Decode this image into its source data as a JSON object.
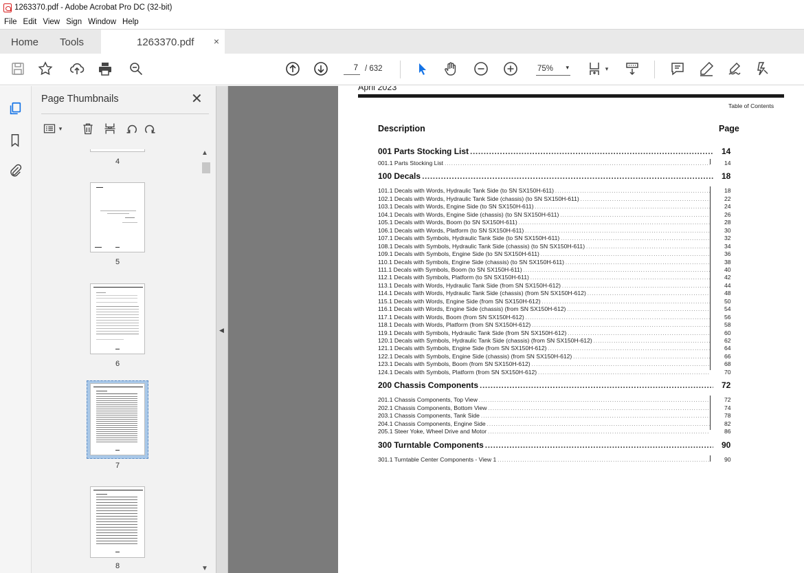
{
  "window": {
    "title": "1263370.pdf - Adobe Acrobat Pro DC (32-bit)"
  },
  "menu": [
    "File",
    "Edit",
    "View",
    "Sign",
    "Window",
    "Help"
  ],
  "tabs": {
    "home": "Home",
    "tools": "Tools",
    "doc": "1263370.pdf",
    "close": "×"
  },
  "toolbar": {
    "page_current": "7",
    "page_total": "/ 632",
    "zoom": "75%"
  },
  "panel": {
    "title": "Page Thumbnails",
    "close": "✕",
    "thumbs": [
      {
        "label": "4"
      },
      {
        "label": "5"
      },
      {
        "label": "6"
      },
      {
        "label": "7"
      },
      {
        "label": "8"
      }
    ]
  },
  "document": {
    "date": "April 2023",
    "toc_label": "Table of Contents",
    "col_description": "Description",
    "col_page": "Page",
    "entries": [
      {
        "kind": "sec",
        "text": "001 Parts Stocking List",
        "page": "14"
      },
      {
        "kind": "sub",
        "text": "001.1 Parts Stocking List",
        "page": "14"
      },
      {
        "kind": "sec",
        "text": "100 Decals",
        "page": "18"
      },
      {
        "kind": "sub",
        "text": "101.1 Decals with Words, Hydraulic Tank Side (to SN SX150H-611)",
        "page": "18"
      },
      {
        "kind": "sub",
        "text": "102.1 Decals with Words, Hydraulic Tank Side (chassis) (to SN SX150H-611)",
        "page": "22"
      },
      {
        "kind": "sub",
        "text": "103.1 Decals with Words, Engine Side (to SN SX150H-611)",
        "page": "24"
      },
      {
        "kind": "sub",
        "text": "104.1 Decals with Words, Engine Side (chassis) (to SN SX150H-611)",
        "page": "26"
      },
      {
        "kind": "sub",
        "text": "105.1 Decals with Words, Boom (to SN SX150H-611)",
        "page": "28"
      },
      {
        "kind": "sub",
        "text": "106.1 Decals with Words, Platform (to SN SX150H-611)",
        "page": "30"
      },
      {
        "kind": "sub",
        "text": "107.1 Decals with Symbols, Hydraulic Tank Side (to SN SX150H-611)",
        "page": "32"
      },
      {
        "kind": "sub",
        "text": "108.1 Decals with Symbols, Hydraulic Tank Side (chassis) (to SN SX150H-611)",
        "page": "34"
      },
      {
        "kind": "sub",
        "text": "109.1 Decals with Symbols, Engine Side (to SN SX150H-611)",
        "page": "36"
      },
      {
        "kind": "sub",
        "text": "110.1 Decals with Symbols, Engine Side (chassis) (to SN SX150H-611)",
        "page": "38"
      },
      {
        "kind": "sub",
        "text": "111.1 Decals with Symbols, Boom (to SN SX150H-611)",
        "page": "40"
      },
      {
        "kind": "sub",
        "text": "112.1 Decals with Symbols, Platform (to SN SX150H-611)",
        "page": "42"
      },
      {
        "kind": "sub",
        "text": "113.1 Decals with Words, Hydraulic Tank Side (from SN SX150H-612)",
        "page": "44"
      },
      {
        "kind": "sub",
        "text": "114.1 Decals with Words, Hydraulic Tank Side (chassis) (from SN SX150H-612)",
        "page": "48"
      },
      {
        "kind": "sub",
        "text": "115.1 Decals with Words, Engine Side (from SN SX150H-612)",
        "page": "50"
      },
      {
        "kind": "sub",
        "text": "116.1 Decals with Words, Engine Side (chassis) (from SN SX150H-612)",
        "page": "54"
      },
      {
        "kind": "sub",
        "text": "117.1 Decals with Words, Boom (from SN SX150H-612)",
        "page": "56"
      },
      {
        "kind": "sub",
        "text": "118.1 Decals with Words, Platform (from SN SX150H-612)",
        "page": "58"
      },
      {
        "kind": "sub",
        "text": "119.1 Decals with Symbols, Hydraulic Tank Side (from SN SX150H-612)",
        "page": "60"
      },
      {
        "kind": "sub",
        "text": "120.1 Decals with Symbols, Hydraulic Tank Side (chassis) (from SN SX150H-612)",
        "page": "62"
      },
      {
        "kind": "sub",
        "text": "121.1 Decals with Symbols, Engine Side (from SN SX150H-612)",
        "page": "64"
      },
      {
        "kind": "sub",
        "text": "122.1 Decals with Symbols, Engine Side (chassis) (from SN SX150H-612)",
        "page": "66"
      },
      {
        "kind": "sub",
        "text": "123.1 Decals with Symbols, Boom (from SN SX150H-612)",
        "page": "68"
      },
      {
        "kind": "sub",
        "text": "124.1 Decals with Symbols, Platform (from SN SX150H-612)",
        "page": "70"
      },
      {
        "kind": "sec",
        "text": "200 Chassis Components",
        "page": "72"
      },
      {
        "kind": "sub",
        "text": "201.1 Chassis Components, Top View",
        "page": "72"
      },
      {
        "kind": "sub",
        "text": "202.1 Chassis Components, Bottom View",
        "page": "74"
      },
      {
        "kind": "sub",
        "text": "203.1 Chassis Components, Tank Side",
        "page": "78"
      },
      {
        "kind": "sub",
        "text": "204.1 Chassis Components, Engine Side",
        "page": "82"
      },
      {
        "kind": "sub",
        "text": "205.1 Steer Yoke, Wheel Drive and Motor",
        "page": "86"
      },
      {
        "kind": "sec",
        "text": "300 Turntable Components",
        "page": "90"
      },
      {
        "kind": "sub",
        "text": "301.1 Turntable Center Components - View 1",
        "page": "90"
      }
    ]
  }
}
